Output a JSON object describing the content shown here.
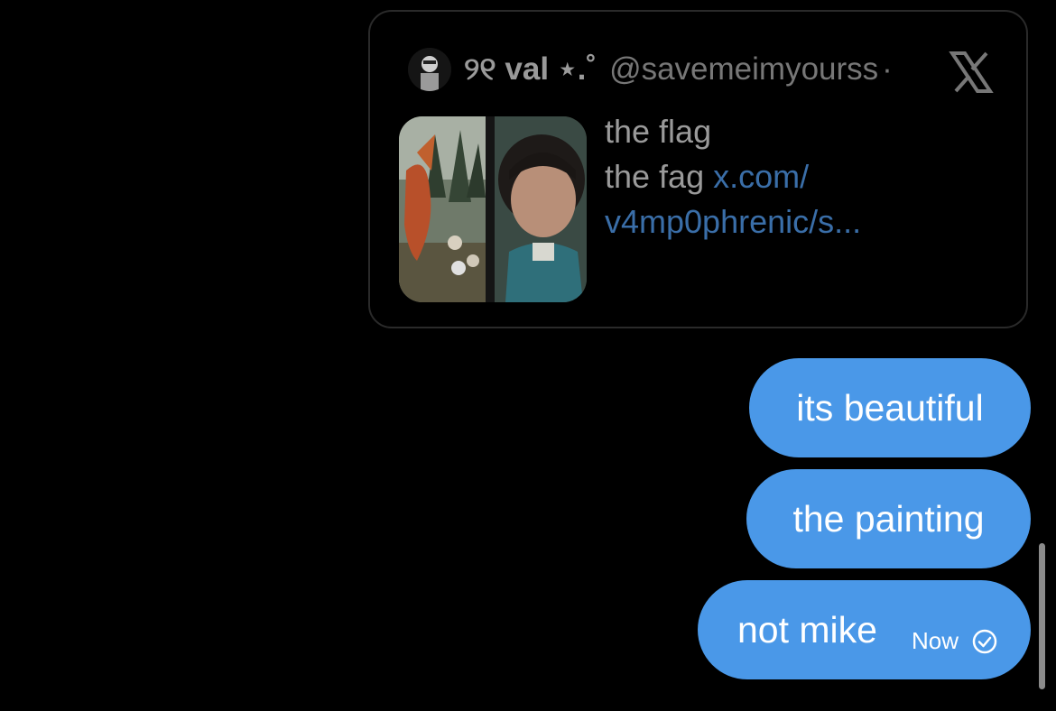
{
  "quoted_post": {
    "display_name": "୨୧ val ⋆.˚",
    "handle": "@savemeimyourss",
    "separator": "·",
    "text_lines": [
      "the flag",
      "the fag"
    ],
    "link_part1": "x.com/",
    "link_part2": "v4mp0phrenic/s..."
  },
  "messages": [
    {
      "text": "its beautiful"
    },
    {
      "text": "the painting"
    },
    {
      "text": "not mike",
      "status": "Now"
    }
  ],
  "colors": {
    "bubble": "#4a98e8",
    "link": "#3a6ea8",
    "background": "#000000"
  }
}
